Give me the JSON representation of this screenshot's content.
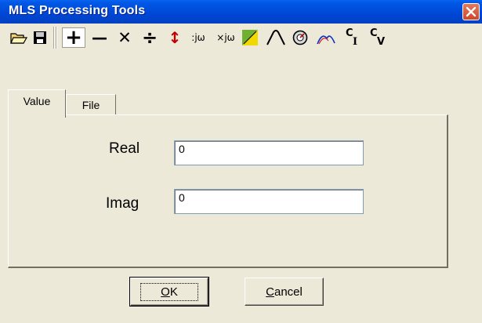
{
  "window": {
    "title": "MLS Processing Tools"
  },
  "toolbar": {
    "items": [
      {
        "name": "open-icon"
      },
      {
        "name": "save-icon"
      },
      {
        "name": "add-icon",
        "glyph": "+",
        "pressed": true
      },
      {
        "name": "subtract-icon",
        "glyph": "—"
      },
      {
        "name": "multiply-icon",
        "glyph": "✕"
      },
      {
        "name": "divide-icon",
        "glyph": "÷"
      },
      {
        "name": "swap-icon",
        "glyph": "↕"
      },
      {
        "name": "divide-jw-icon",
        "glyph": ":jω"
      },
      {
        "name": "multiply-jw-icon",
        "glyph": "×jω"
      },
      {
        "name": "spl-icon"
      },
      {
        "name": "curve-icon"
      },
      {
        "name": "dial-icon"
      },
      {
        "name": "arc-icon"
      },
      {
        "name": "ci-icon",
        "glyph": "CI"
      },
      {
        "name": "cv-icon",
        "glyph": "CV"
      }
    ]
  },
  "tabs": [
    {
      "label": "Value",
      "active": true
    },
    {
      "label": "File",
      "active": false
    }
  ],
  "form": {
    "real_label": "Real",
    "real_value": "0",
    "imag_label": "Imag",
    "imag_value": "0"
  },
  "buttons": {
    "ok_label_underlined": "O",
    "ok_label_rest": "K",
    "cancel_label_underlined": "C",
    "cancel_label_rest": "ancel"
  },
  "colors": {
    "title_bar": "#0046d5",
    "close_button": "#d0462a",
    "face": "#ece9d8"
  }
}
